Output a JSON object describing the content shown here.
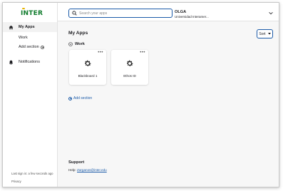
{
  "brand": {
    "logo_text": "INTER"
  },
  "sidebar": {
    "items": [
      {
        "label": "My Apps",
        "icon": "home-icon"
      },
      {
        "label": "Notifications",
        "icon": "bell-icon"
      }
    ],
    "sub_items": [
      {
        "label": "Work"
      },
      {
        "label": "Add section"
      }
    ],
    "last_signin": "Last sign in: a few seconds ago",
    "privacy_label": "Privacy"
  },
  "topbar": {
    "search_placeholder": "Search your apps",
    "user_name": "OLGA",
    "user_org": "Universidad Interamer..."
  },
  "main": {
    "title": "My Apps",
    "sort_label": "Sort",
    "section_name": "Work",
    "apps": [
      {
        "name": "Blackboard 1",
        "icon": "gear-icon",
        "menu": "•••"
      },
      {
        "name": "Ethos ID",
        "icon": "gear-icon",
        "menu": "•••"
      }
    ],
    "add_section_label": "Add section"
  },
  "support": {
    "title": "Support",
    "help_prefix": "Help:",
    "help_email": "Zarganos@inter.edu"
  },
  "colors": {
    "accent": "#1a5aa8",
    "brand_green": "#0d7a2a",
    "brand_yellow": "#e8b400"
  }
}
